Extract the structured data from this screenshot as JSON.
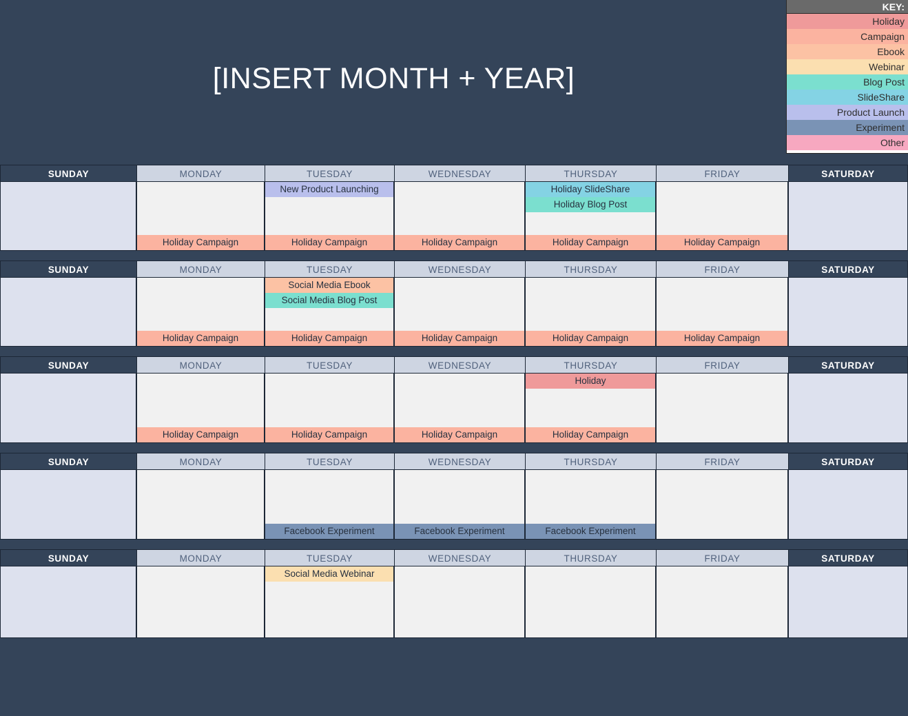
{
  "header": {
    "title": "[INSERT MONTH + YEAR]"
  },
  "key": {
    "header_label": "KEY:",
    "items": [
      {
        "label": "Holiday",
        "color": "#ef9a9a",
        "swatch": "c-holiday"
      },
      {
        "label": "Campaign",
        "color": "#fbb3a0",
        "swatch": "c-campaign"
      },
      {
        "label": "Ebook",
        "color": "#fcc2a4",
        "swatch": "c-ebook"
      },
      {
        "label": "Webinar",
        "color": "#fbdfb0",
        "swatch": "c-webinar"
      },
      {
        "label": "Blog Post",
        "color": "#7bdfcf",
        "swatch": "c-blogpost"
      },
      {
        "label": "SlideShare",
        "color": "#84d3e4",
        "swatch": "c-slideshare"
      },
      {
        "label": "Product Launch",
        "color": "#b9bfec",
        "swatch": "c-productlaunch"
      },
      {
        "label": "Experiment",
        "color": "#7a93b5",
        "swatch": "c-experiment"
      },
      {
        "label": "Other",
        "color": "#f7a8c0",
        "swatch": "c-other"
      }
    ]
  },
  "calendar": {
    "day_names": [
      "SUNDAY",
      "MONDAY",
      "TUESDAY",
      "WEDNESDAY",
      "THURSDAY",
      "FRIDAY",
      "SATURDAY"
    ],
    "weeks": [
      {
        "index": 1,
        "days": [
          {
            "day": "SUNDAY",
            "weekend": true,
            "top_events": [],
            "bottom_events": []
          },
          {
            "day": "MONDAY",
            "weekend": false,
            "top_events": [],
            "bottom_events": [
              {
                "label": "Holiday Campaign",
                "type": "Campaign",
                "swatch": "c-campaign"
              }
            ]
          },
          {
            "day": "TUESDAY",
            "weekend": false,
            "top_events": [
              {
                "label": "New Product Launching",
                "type": "Product Launch",
                "swatch": "c-productlaunch"
              }
            ],
            "bottom_events": [
              {
                "label": "Holiday Campaign",
                "type": "Campaign",
                "swatch": "c-campaign"
              }
            ]
          },
          {
            "day": "WEDNESDAY",
            "weekend": false,
            "top_events": [],
            "bottom_events": [
              {
                "label": "Holiday Campaign",
                "type": "Campaign",
                "swatch": "c-campaign"
              }
            ]
          },
          {
            "day": "THURSDAY",
            "weekend": false,
            "top_events": [
              {
                "label": "Holiday SlideShare",
                "type": "SlideShare",
                "swatch": "c-slideshare"
              },
              {
                "label": "Holiday Blog Post",
                "type": "Blog Post",
                "swatch": "c-blogpost"
              }
            ],
            "bottom_events": [
              {
                "label": "Holiday Campaign",
                "type": "Campaign",
                "swatch": "c-campaign"
              }
            ]
          },
          {
            "day": "FRIDAY",
            "weekend": false,
            "top_events": [],
            "bottom_events": [
              {
                "label": "Holiday Campaign",
                "type": "Campaign",
                "swatch": "c-campaign"
              }
            ]
          },
          {
            "day": "SATURDAY",
            "weekend": true,
            "top_events": [],
            "bottom_events": []
          }
        ]
      },
      {
        "index": 2,
        "days": [
          {
            "day": "SUNDAY",
            "weekend": true,
            "top_events": [],
            "bottom_events": []
          },
          {
            "day": "MONDAY",
            "weekend": false,
            "top_events": [],
            "bottom_events": [
              {
                "label": "Holiday Campaign",
                "type": "Campaign",
                "swatch": "c-campaign"
              }
            ]
          },
          {
            "day": "TUESDAY",
            "weekend": false,
            "top_events": [
              {
                "label": "Social Media Ebook",
                "type": "Ebook",
                "swatch": "c-ebook"
              },
              {
                "label": "Social Media Blog Post",
                "type": "Blog Post",
                "swatch": "c-blogpost"
              }
            ],
            "bottom_events": [
              {
                "label": "Holiday Campaign",
                "type": "Campaign",
                "swatch": "c-campaign"
              }
            ]
          },
          {
            "day": "WEDNESDAY",
            "weekend": false,
            "top_events": [],
            "bottom_events": [
              {
                "label": "Holiday Campaign",
                "type": "Campaign",
                "swatch": "c-campaign"
              }
            ]
          },
          {
            "day": "THURSDAY",
            "weekend": false,
            "top_events": [],
            "bottom_events": [
              {
                "label": "Holiday Campaign",
                "type": "Campaign",
                "swatch": "c-campaign"
              }
            ]
          },
          {
            "day": "FRIDAY",
            "weekend": false,
            "top_events": [],
            "bottom_events": [
              {
                "label": "Holiday Campaign",
                "type": "Campaign",
                "swatch": "c-campaign"
              }
            ]
          },
          {
            "day": "SATURDAY",
            "weekend": true,
            "top_events": [],
            "bottom_events": []
          }
        ]
      },
      {
        "index": 3,
        "days": [
          {
            "day": "SUNDAY",
            "weekend": true,
            "top_events": [],
            "bottom_events": []
          },
          {
            "day": "MONDAY",
            "weekend": false,
            "top_events": [],
            "bottom_events": [
              {
                "label": "Holiday Campaign",
                "type": "Campaign",
                "swatch": "c-campaign"
              }
            ]
          },
          {
            "day": "TUESDAY",
            "weekend": false,
            "top_events": [],
            "bottom_events": [
              {
                "label": "Holiday Campaign",
                "type": "Campaign",
                "swatch": "c-campaign"
              }
            ]
          },
          {
            "day": "WEDNESDAY",
            "weekend": false,
            "top_events": [],
            "bottom_events": [
              {
                "label": "Holiday Campaign",
                "type": "Campaign",
                "swatch": "c-campaign"
              }
            ]
          },
          {
            "day": "THURSDAY",
            "weekend": false,
            "top_events": [
              {
                "label": "Holiday",
                "type": "Holiday",
                "swatch": "c-holiday"
              }
            ],
            "bottom_events": [
              {
                "label": "Holiday Campaign",
                "type": "Campaign",
                "swatch": "c-campaign"
              }
            ]
          },
          {
            "day": "FRIDAY",
            "weekend": false,
            "top_events": [],
            "bottom_events": []
          },
          {
            "day": "SATURDAY",
            "weekend": true,
            "top_events": [],
            "bottom_events": []
          }
        ]
      },
      {
        "index": 4,
        "days": [
          {
            "day": "SUNDAY",
            "weekend": true,
            "top_events": [],
            "bottom_events": []
          },
          {
            "day": "MONDAY",
            "weekend": false,
            "top_events": [],
            "bottom_events": []
          },
          {
            "day": "TUESDAY",
            "weekend": false,
            "top_events": [],
            "bottom_events": [
              {
                "label": "Facebook Experiment",
                "type": "Experiment",
                "swatch": "c-experiment"
              }
            ]
          },
          {
            "day": "WEDNESDAY",
            "weekend": false,
            "top_events": [],
            "bottom_events": [
              {
                "label": "Facebook Experiment",
                "type": "Experiment",
                "swatch": "c-experiment"
              }
            ]
          },
          {
            "day": "THURSDAY",
            "weekend": false,
            "top_events": [],
            "bottom_events": [
              {
                "label": "Facebook Experiment",
                "type": "Experiment",
                "swatch": "c-experiment"
              }
            ]
          },
          {
            "day": "FRIDAY",
            "weekend": false,
            "top_events": [],
            "bottom_events": []
          },
          {
            "day": "SATURDAY",
            "weekend": true,
            "top_events": [],
            "bottom_events": []
          }
        ]
      },
      {
        "index": 5,
        "days": [
          {
            "day": "SUNDAY",
            "weekend": true,
            "top_events": [],
            "bottom_events": []
          },
          {
            "day": "MONDAY",
            "weekend": false,
            "top_events": [],
            "bottom_events": []
          },
          {
            "day": "TUESDAY",
            "weekend": false,
            "top_events": [
              {
                "label": "Social Media Webinar",
                "type": "Webinar",
                "swatch": "c-webinar"
              }
            ],
            "bottom_events": []
          },
          {
            "day": "WEDNESDAY",
            "weekend": false,
            "top_events": [],
            "bottom_events": []
          },
          {
            "day": "THURSDAY",
            "weekend": false,
            "top_events": [],
            "bottom_events": []
          },
          {
            "day": "FRIDAY",
            "weekend": false,
            "top_events": [],
            "bottom_events": []
          },
          {
            "day": "SATURDAY",
            "weekend": true,
            "top_events": [],
            "bottom_events": []
          }
        ]
      }
    ]
  }
}
